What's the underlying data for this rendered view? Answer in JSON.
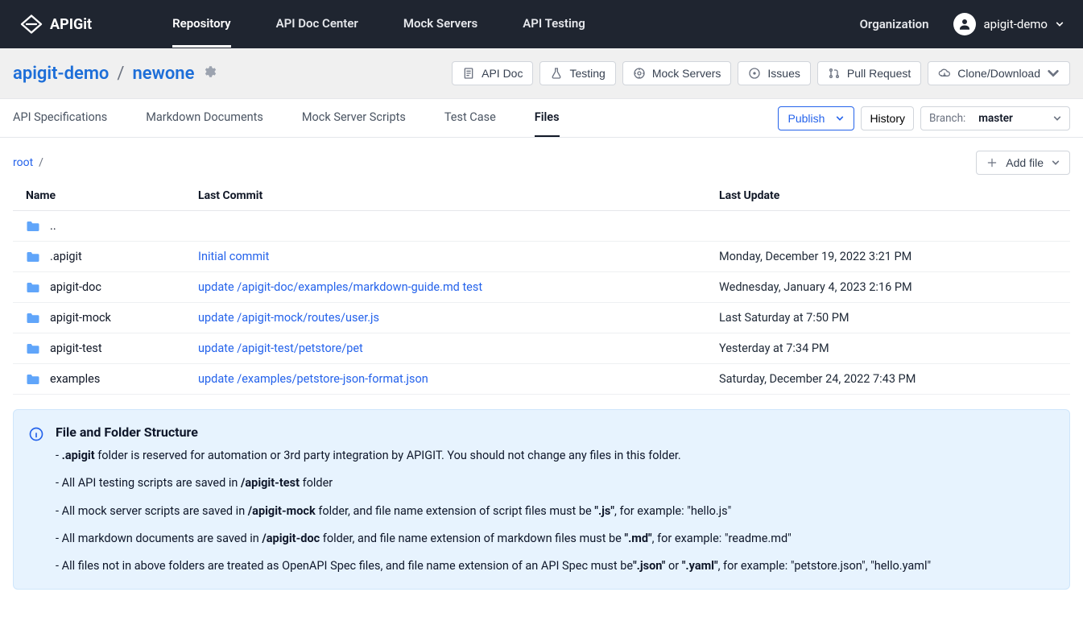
{
  "brand": {
    "name": "APIGit"
  },
  "topnav": {
    "items": [
      {
        "label": "Repository",
        "active": true
      },
      {
        "label": "API Doc Center",
        "active": false
      },
      {
        "label": "Mock Servers",
        "active": false
      },
      {
        "label": "API Testing",
        "active": false
      }
    ],
    "org_label": "Organization",
    "user": "apigit-demo"
  },
  "subheader": {
    "owner": "apigit-demo",
    "sep": "/",
    "repo": "newone",
    "buttons": {
      "api_doc": "API Doc",
      "testing": "Testing",
      "mock_servers": "Mock Servers",
      "issues": "Issues",
      "pull_request": "Pull Request",
      "clone": "Clone/Download"
    }
  },
  "repo_tabs": {
    "items": [
      {
        "label": "API Specifications",
        "active": false
      },
      {
        "label": "Markdown Documents",
        "active": false
      },
      {
        "label": "Mock Server Scripts",
        "active": false
      },
      {
        "label": "Test Case",
        "active": false
      },
      {
        "label": "Files",
        "active": true
      }
    ],
    "publish_label": "Publish",
    "history_label": "History",
    "branch_label": "Branch:",
    "branch_value": "master"
  },
  "path": {
    "root_label": "root",
    "sep": "/"
  },
  "addfile_label": "Add file",
  "table": {
    "headers": {
      "name": "Name",
      "commit": "Last Commit",
      "update": "Last Update"
    },
    "rows": [
      {
        "name": "..",
        "commit": "",
        "update": "",
        "is_up": true
      },
      {
        "name": ".apigit",
        "commit": "Initial commit",
        "update": "Monday, December 19, 2022 3:21 PM"
      },
      {
        "name": "apigit-doc",
        "commit": "update /apigit-doc/examples/markdown-guide.md test",
        "update": "Wednesday, January 4, 2023 2:16 PM"
      },
      {
        "name": "apigit-mock",
        "commit": "update /apigit-mock/routes/user.js",
        "update": "Last Saturday at 7:50 PM"
      },
      {
        "name": "apigit-test",
        "commit": "update /apigit-test/petstore/pet",
        "update": "Yesterday at 7:34 PM"
      },
      {
        "name": "examples",
        "commit": "update /examples/petstore-json-format.json",
        "update": "Saturday, December 24, 2022 7:43 PM"
      }
    ]
  },
  "info": {
    "title": "File and Folder Structure",
    "lines": {
      "l1a": "- ",
      "l1b": ".apigit",
      "l1c": " folder is reserved for automation or 3rd party integration by APIGIT. You should not change any files in this folder.",
      "l2a": "- All API testing scripts are saved in ",
      "l2b": "/apigit-test",
      "l2c": " folder",
      "l3a": "- All mock server scripts are saved in ",
      "l3b": "/apigit-mock",
      "l3c": " folder, and file name extension of script files must be ",
      "l3d": "\".js\"",
      "l3e": ", for example: \"hello.js\"",
      "l4a": "- All markdown documents are saved in ",
      "l4b": "/apigit-doc",
      "l4c": " folder, and file name extension of markdown files must be ",
      "l4d": "\".md\"",
      "l4e": ", for example: \"readme.md\"",
      "l5a": "- All files not in above folders are treated as OpenAPI Spec files, and file name extension of an API Spec must be",
      "l5b": "\".json\"",
      "l5c": " or ",
      "l5d": "\".yaml\"",
      "l5e": ", for example: \"petstore.json\", \"hello.yaml\""
    }
  }
}
